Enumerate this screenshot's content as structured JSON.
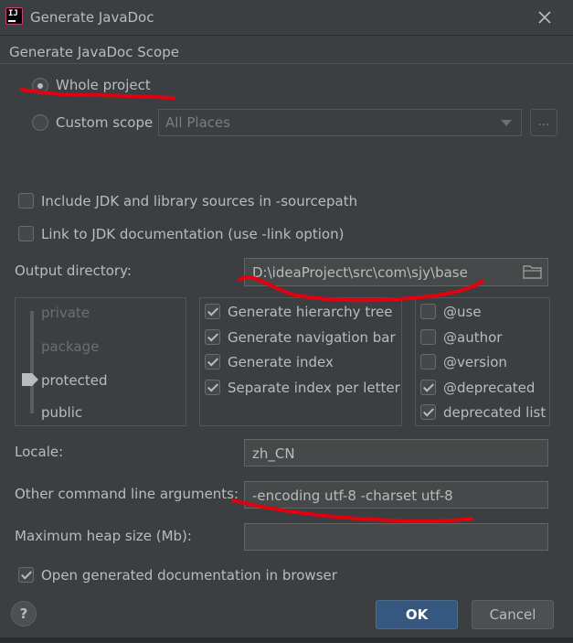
{
  "window": {
    "title": "Generate JavaDoc",
    "app_icon_text": "IJ"
  },
  "scope": {
    "title": "Generate JavaDoc Scope",
    "whole_project_label": "Whole project",
    "whole_project_selected": true,
    "custom_scope_label": "Custom scope",
    "custom_scope_value": "All Places",
    "browse_label": "..."
  },
  "options": {
    "include_jdk_label": "Include JDK and library sources in -sourcepath",
    "include_jdk_checked": false,
    "link_jdk_label": "Link to JDK documentation (use -link option)",
    "link_jdk_checked": false
  },
  "output": {
    "label": "Output directory:",
    "value": "D:\\ideaProject\\src\\com\\sjy\\base"
  },
  "visibility": {
    "levels": [
      "private",
      "package",
      "protected",
      "public"
    ],
    "selected": "protected"
  },
  "generate": [
    {
      "label": "Generate hierarchy tree",
      "checked": true
    },
    {
      "label": "Generate navigation bar",
      "checked": true
    },
    {
      "label": "Generate index",
      "checked": true
    },
    {
      "label": "Separate index per letter",
      "checked": true
    }
  ],
  "tags": [
    {
      "label": "@use",
      "checked": false
    },
    {
      "label": "@author",
      "checked": false
    },
    {
      "label": "@version",
      "checked": false
    },
    {
      "label": "@deprecated",
      "checked": true
    },
    {
      "label": "deprecated list",
      "checked": true
    }
  ],
  "locale": {
    "label": "Locale:",
    "value": "zh_CN"
  },
  "other_args": {
    "label": "Other command line arguments:",
    "value": "-encoding utf-8 -charset utf-8"
  },
  "heap": {
    "label": "Maximum heap size (Mb):",
    "value": ""
  },
  "open_browser": {
    "label": "Open generated documentation in browser",
    "checked": true
  },
  "buttons": {
    "help": "?",
    "ok": "OK",
    "cancel": "Cancel"
  },
  "annotation_color": "#e3000f"
}
